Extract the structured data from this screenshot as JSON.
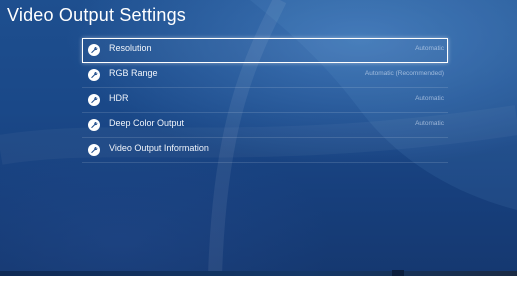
{
  "page": {
    "title": "Video Output Settings"
  },
  "menu": {
    "items": [
      {
        "label": "Resolution",
        "value": "Automatic",
        "icon": "wrench-icon",
        "selected": true
      },
      {
        "label": "RGB Range",
        "value": "Automatic (Recommended)",
        "icon": "wrench-icon",
        "selected": false
      },
      {
        "label": "HDR",
        "value": "Automatic",
        "icon": "wrench-icon",
        "selected": false
      },
      {
        "label": "Deep Color Output",
        "value": "Automatic",
        "icon": "wrench-icon",
        "selected": false
      },
      {
        "label": "Video Output Information",
        "value": "",
        "icon": "wrench-icon",
        "selected": false
      }
    ]
  },
  "colors": {
    "background": "#1a4888",
    "text": "#ffffff",
    "selection_border": "#ffffff"
  }
}
